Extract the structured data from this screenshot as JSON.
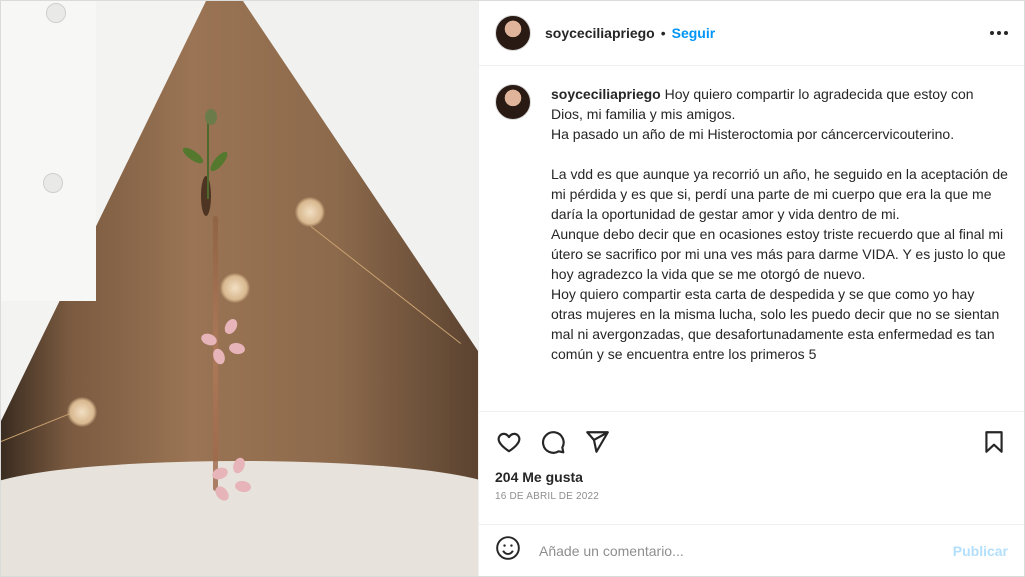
{
  "header": {
    "username": "soyceciliapriego",
    "separator": "•",
    "follow_label": "Seguir",
    "more_icon": "more-horizontal-icon"
  },
  "caption": {
    "username": "soyceciliapriego",
    "paragraphs": [
      "Hoy quiero compartir lo agradecida que estoy con Dios, mi familia  y mis amigos.",
      "Ha pasado un año de mi Histeroctomia por cáncercervicouterino.",
      "",
      "La vdd es que  aunque ya recorrió un año, he seguido en la aceptación de mi pérdida y es que si, perdí una parte de mi cuerpo que era la que me daría la oportunidad de gestar amor y vida dentro de mi.",
      "Aunque debo decir que en ocasiones estoy triste recuerdo que al final mi útero se sacrifico por mi una ves más para darme VIDA. Y es justo lo que hoy agradezco  la vida que se me otorgó de nuevo.",
      "Hoy quiero compartir esta carta de despedida y se que como yo hay otras mujeres en la misma lucha, solo les puedo decir que no se sientan mal ni avergonzadas, que desafortunadamente esta enfermedad es tan común  y se encuentra entre los primeros 5"
    ]
  },
  "actions": {
    "like_icon": "heart-icon",
    "comment_icon": "comment-icon",
    "share_icon": "paper-plane-icon",
    "save_icon": "bookmark-icon"
  },
  "likes": "204 Me gusta",
  "date": "16 DE ABRIL DE 2022",
  "comment_box": {
    "emoji_icon": "smiley-icon",
    "placeholder": "Añade un comentario...",
    "publish_label": "Publicar"
  },
  "colors": {
    "link": "#0095f6",
    "publish_disabled": "#b2dffc",
    "text": "#262626",
    "muted": "#8e8e8e"
  }
}
